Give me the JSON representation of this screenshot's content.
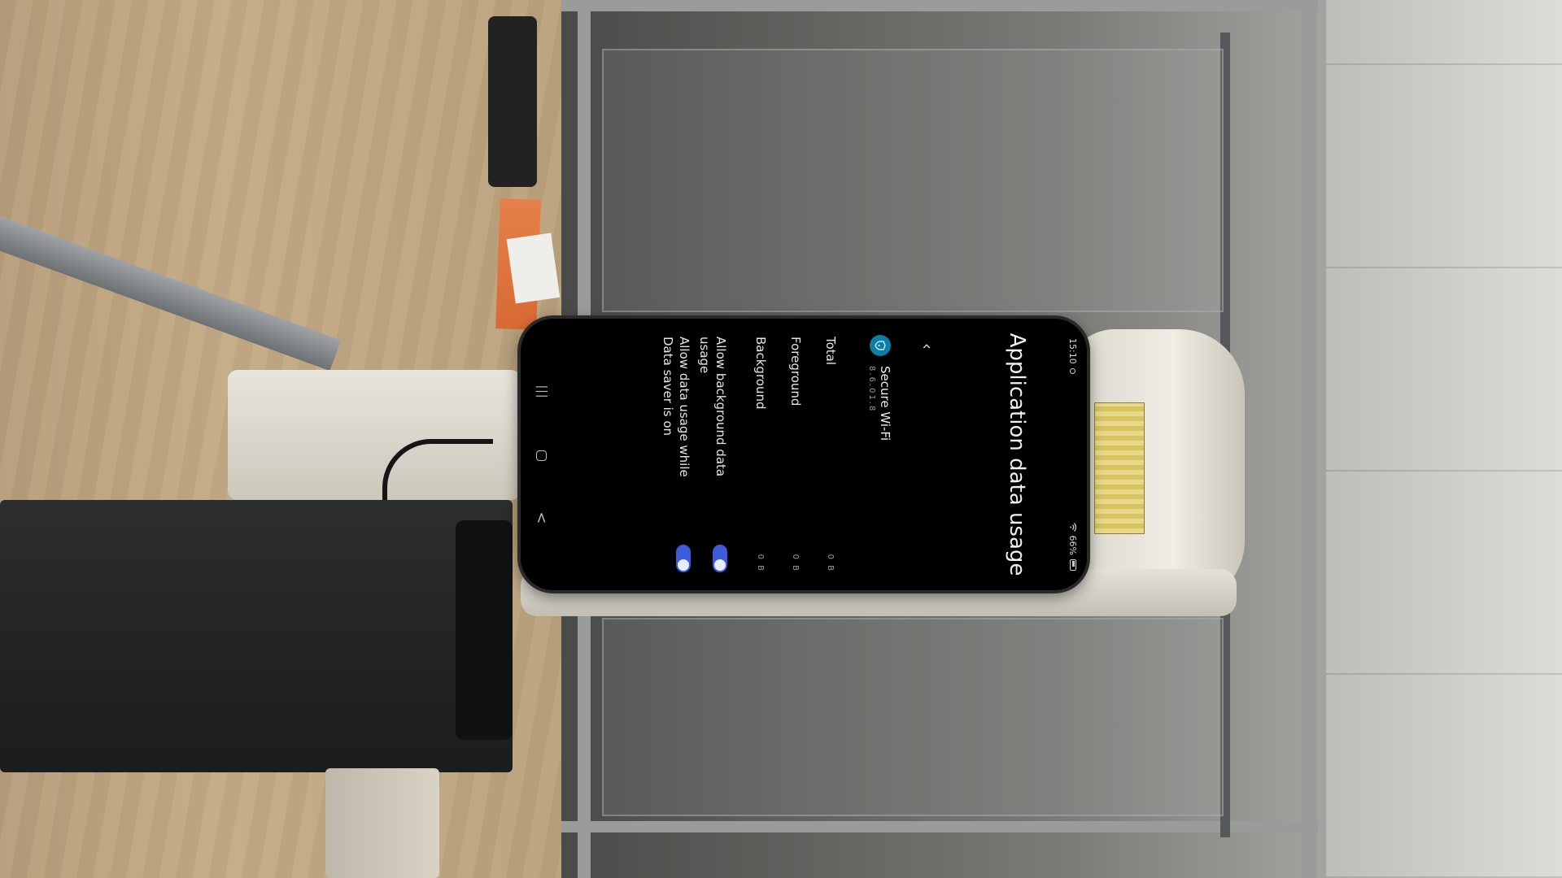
{
  "status_bar": {
    "time": "15:10",
    "battery": "66%"
  },
  "header": {
    "title": "Application data usage"
  },
  "app": {
    "name": "Secure Wi-Fi",
    "version": "8.6.01.8"
  },
  "usage": [
    {
      "label": "Total",
      "value": "0 B"
    },
    {
      "label": "Foreground",
      "value": "0 B"
    },
    {
      "label": "Background",
      "value": "0 B"
    }
  ],
  "settings": [
    {
      "label": "Allow background data usage",
      "enabled": true
    },
    {
      "label": "Allow data usage while Data saver is on",
      "enabled": true
    }
  ],
  "nav": {
    "recents": "|||",
    "back": "<"
  },
  "colors": {
    "accent_toggle": "#3d5bdb",
    "app_icon": "#0a7fa8",
    "screen_bg": "#000000"
  }
}
